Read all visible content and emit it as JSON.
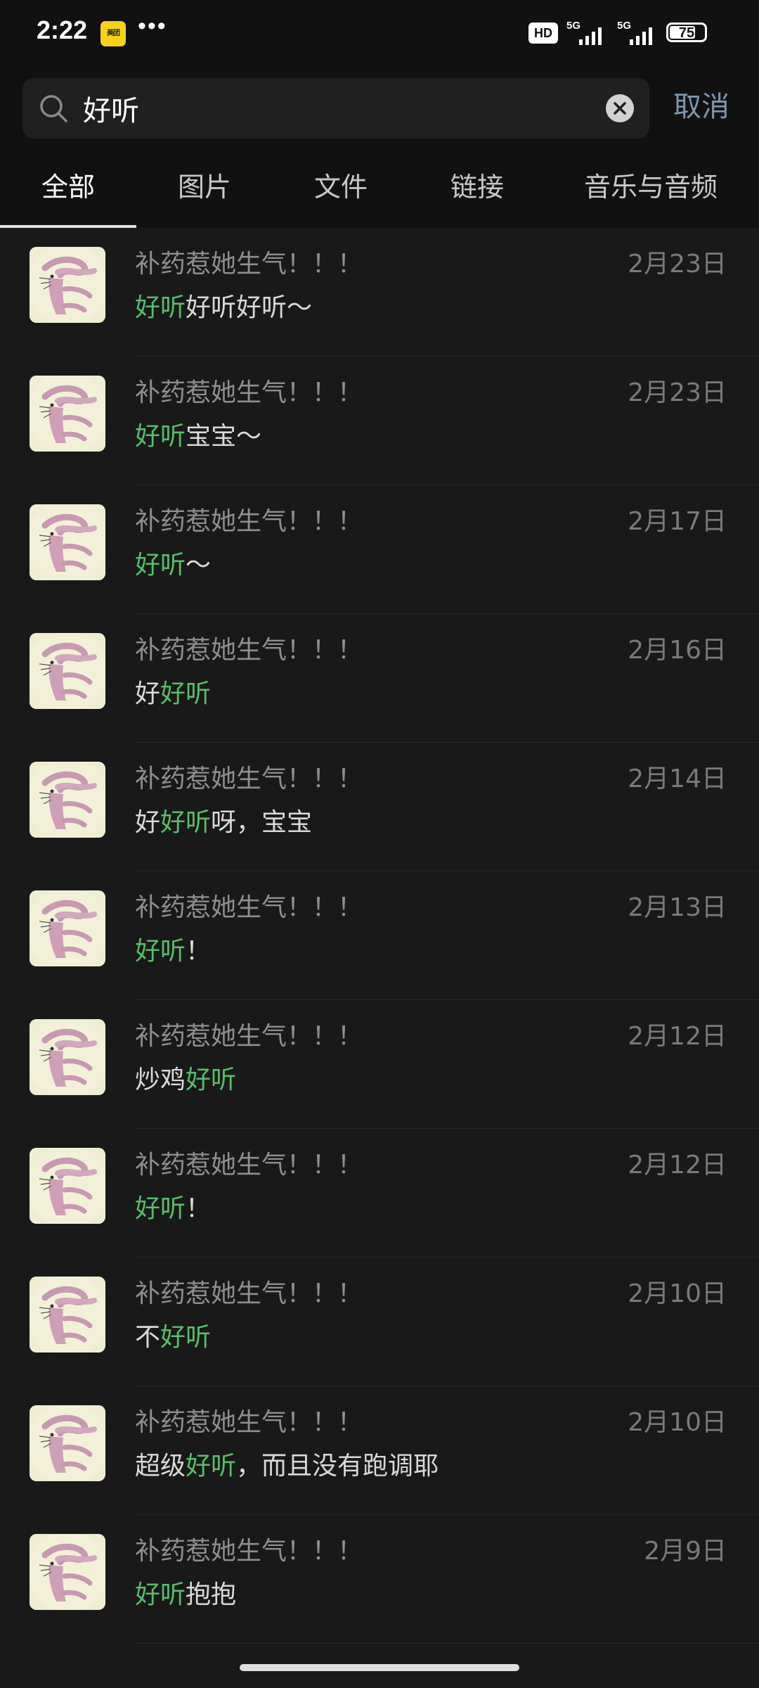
{
  "status_bar": {
    "time": "2:22",
    "app_badge": "美团",
    "more": "•••",
    "network_badge": "HD",
    "signal_1": "5G",
    "signal_2": "5G",
    "battery": "75"
  },
  "search": {
    "query": "好听",
    "cancel_label": "取消"
  },
  "tabs": [
    {
      "label": "全部",
      "active": true
    },
    {
      "label": "图片",
      "active": false
    },
    {
      "label": "文件",
      "active": false
    },
    {
      "label": "链接",
      "active": false
    },
    {
      "label": "音乐与音频",
      "active": false
    }
  ],
  "highlight_color": "#57be6a",
  "results": [
    {
      "name": "补药惹她生气！！！",
      "date": "2月23日",
      "before": "",
      "match": "好听",
      "after": "好听好听～"
    },
    {
      "name": "补药惹她生气！！！",
      "date": "2月23日",
      "before": "",
      "match": "好听",
      "after": "宝宝～"
    },
    {
      "name": "补药惹她生气！！！",
      "date": "2月17日",
      "before": "",
      "match": "好听",
      "after": "～"
    },
    {
      "name": "补药惹她生气！！！",
      "date": "2月16日",
      "before": "好",
      "match": "好听",
      "after": ""
    },
    {
      "name": "补药惹她生气！！！",
      "date": "2月14日",
      "before": "好",
      "match": "好听",
      "after": "呀，宝宝"
    },
    {
      "name": "补药惹她生气！！！",
      "date": "2月13日",
      "before": "",
      "match": "好听",
      "after": "！"
    },
    {
      "name": "补药惹她生气！！！",
      "date": "2月12日",
      "before": "炒鸡",
      "match": "好听",
      "after": ""
    },
    {
      "name": "补药惹她生气！！！",
      "date": "2月12日",
      "before": "",
      "match": "好听",
      "after": "！"
    },
    {
      "name": "补药惹她生气！！！",
      "date": "2月10日",
      "before": "不",
      "match": "好听",
      "after": ""
    },
    {
      "name": "补药惹她生气！！！",
      "date": "2月10日",
      "before": "超级",
      "match": "好听",
      "after": "，而且没有跑调耶"
    },
    {
      "name": "补药惹她生气！！！",
      "date": "2月9日",
      "before": "",
      "match": "好听",
      "after": "抱抱"
    }
  ]
}
